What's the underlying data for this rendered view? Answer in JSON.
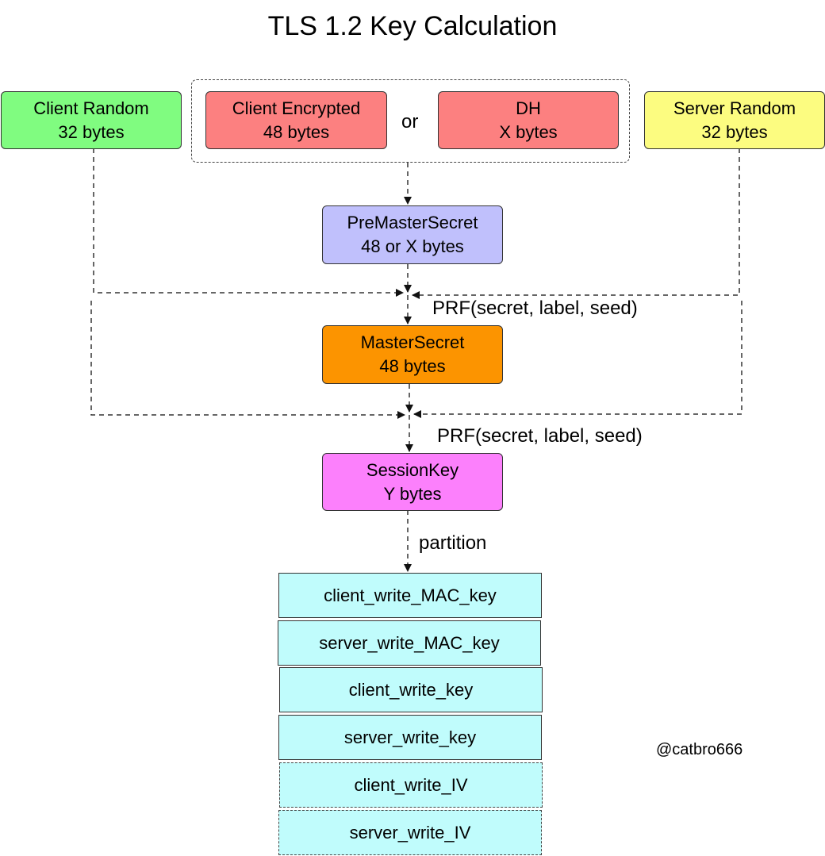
{
  "title": "TLS 1.2 Key Calculation",
  "nodes": {
    "client_random": {
      "name": "Client Random",
      "size": "32 bytes",
      "color": "#80fc80"
    },
    "client_encrypted": {
      "name": "Client Encrypted",
      "size": "48 bytes",
      "color": "#fc8080"
    },
    "or_label": "or",
    "dh": {
      "name": "DH",
      "size": "X bytes",
      "color": "#fc8080"
    },
    "server_random": {
      "name": "Server Random",
      "size": "32 bytes",
      "color": "#fcfc80"
    },
    "premaster": {
      "name": "PreMasterSecret",
      "size": "48 or X bytes",
      "color": "#c0c0fc"
    },
    "master": {
      "name": "MasterSecret",
      "size": "48 bytes",
      "color": "#fc9400"
    },
    "session": {
      "name": "SessionKey",
      "size": "Y bytes",
      "color": "#fc80fc"
    }
  },
  "edges": {
    "prf1": "PRF(secret, label, seed)",
    "prf2": "PRF(secret, label, seed)",
    "partition": "partition"
  },
  "keys": [
    {
      "label": "client_write_MAC_key",
      "style": "solid"
    },
    {
      "label": "server_write_MAC_key",
      "style": "solid"
    },
    {
      "label": "client_write_key",
      "style": "solid"
    },
    {
      "label": "server_write_key",
      "style": "solid"
    },
    {
      "label": "client_write_IV",
      "style": "dashed"
    },
    {
      "label": "server_write_IV",
      "style": "dashed"
    }
  ],
  "key_color": "#c0fcfc",
  "credit": "@catbro666"
}
